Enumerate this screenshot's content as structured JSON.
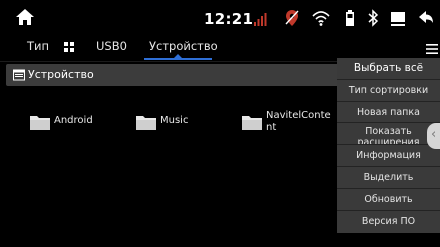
{
  "statusbar": {
    "time": "12:21",
    "icons": [
      "home-icon",
      "signal-icon",
      "gps-off-icon",
      "wifi-icon",
      "battery-icon",
      "bluetooth-icon",
      "screen-icon",
      "back-icon"
    ],
    "signal_color": "#c0392b"
  },
  "tabs": [
    {
      "label": "Тип"
    },
    {
      "label": "USB0"
    },
    {
      "label": "Устройство"
    }
  ],
  "selected_tab": "Устройство",
  "accent_color": "#2f6fd6",
  "path": {
    "label": "Устройство"
  },
  "files": [
    {
      "name": "Android"
    },
    {
      "name": "Music"
    },
    {
      "name": "NavitelConte\nnt"
    }
  ],
  "context_menu": {
    "items": [
      {
        "label": "Выбрать всё"
      },
      {
        "label": "Тип сортировки"
      },
      {
        "label": "Новая папка"
      },
      {
        "label": "Показать расширения"
      },
      {
        "label": "Информация"
      },
      {
        "label": "Выделить"
      },
      {
        "label": "Обновить"
      },
      {
        "label": "Версия ПО"
      }
    ]
  }
}
